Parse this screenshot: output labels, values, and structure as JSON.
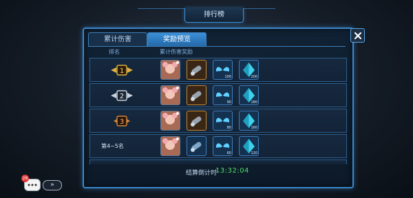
{
  "header": {
    "title": "排行榜"
  },
  "tabs": [
    {
      "label": "累计伤害",
      "active": false
    },
    {
      "label": "奖励预览",
      "active": true
    }
  ],
  "columns": {
    "rank": "排名",
    "reward": "累计伤害奖励"
  },
  "rows": [
    {
      "rank": "1",
      "badge": "gold-rank-1-badge",
      "items": [
        {
          "kind": "avatar",
          "count": ""
        },
        {
          "kind": "gold-missile",
          "count": ""
        },
        {
          "kind": "wings",
          "count": "100"
        },
        {
          "kind": "crystal",
          "count": "200"
        }
      ]
    },
    {
      "rank": "2",
      "badge": "silver-rank-2-badge",
      "items": [
        {
          "kind": "avatar",
          "count": ""
        },
        {
          "kind": "gold-missile",
          "count": ""
        },
        {
          "kind": "wings",
          "count": "90"
        },
        {
          "kind": "crystal",
          "count": "180"
        }
      ]
    },
    {
      "rank": "3",
      "badge": "bronze-rank-3-badge",
      "items": [
        {
          "kind": "avatar",
          "count": ""
        },
        {
          "kind": "gold-missile",
          "count": ""
        },
        {
          "kind": "wings",
          "count": "80"
        },
        {
          "kind": "crystal",
          "count": "160"
        }
      ]
    },
    {
      "rank_text": "第4~5名",
      "items": [
        {
          "kind": "avatar",
          "count": ""
        },
        {
          "kind": "blue-missile",
          "count": ""
        },
        {
          "kind": "wings",
          "count": "60"
        },
        {
          "kind": "crystal",
          "count": "120"
        }
      ]
    }
  ],
  "footer": {
    "timer_label": "结算倒计时",
    "timer_value": "13:32:04"
  },
  "chat": {
    "badge_count": "28",
    "arrow": "»"
  },
  "colors": {
    "accent": "#3b88cc",
    "timer": "#53e06a",
    "gold": "#e0b040"
  }
}
